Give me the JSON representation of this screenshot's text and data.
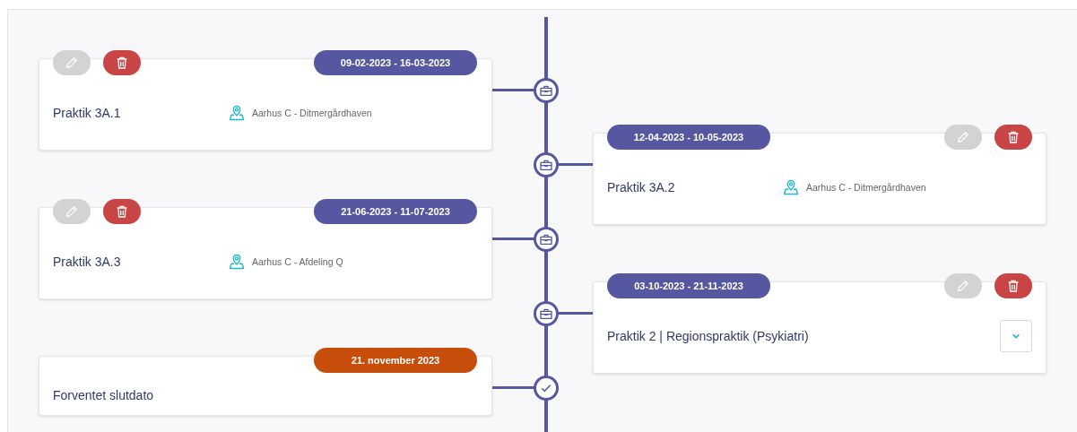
{
  "timeline": [
    {
      "right_side": false,
      "kind": "placement",
      "dates": "09-02-2023 - 16-03-2023",
      "title": "Praktik 3A.1",
      "location": "Aarhus C - Ditmergårdhaven",
      "edit_disabled": true
    },
    {
      "right_side": true,
      "kind": "placement",
      "dates": "12-04-2023 - 10-05-2023",
      "title": "Praktik 3A.2",
      "location": "Aarhus C - Ditmergårdhaven",
      "edit_disabled": true
    },
    {
      "right_side": false,
      "kind": "placement",
      "dates": "21-06-2023 - 11-07-2023",
      "title": "Praktik 3A.3",
      "location": "Aarhus C - Afdeling Q",
      "edit_disabled": true
    },
    {
      "right_side": true,
      "kind": "placement",
      "dates": "03-10-2023 - 21-11-2023",
      "title": "Praktik 2 | Regionspraktik (Psykiatri)",
      "edit_disabled": true,
      "expanded": false
    },
    {
      "right_side": false,
      "kind": "end",
      "dates": "21. november 2023",
      "title": "Forventet slutdato"
    }
  ]
}
